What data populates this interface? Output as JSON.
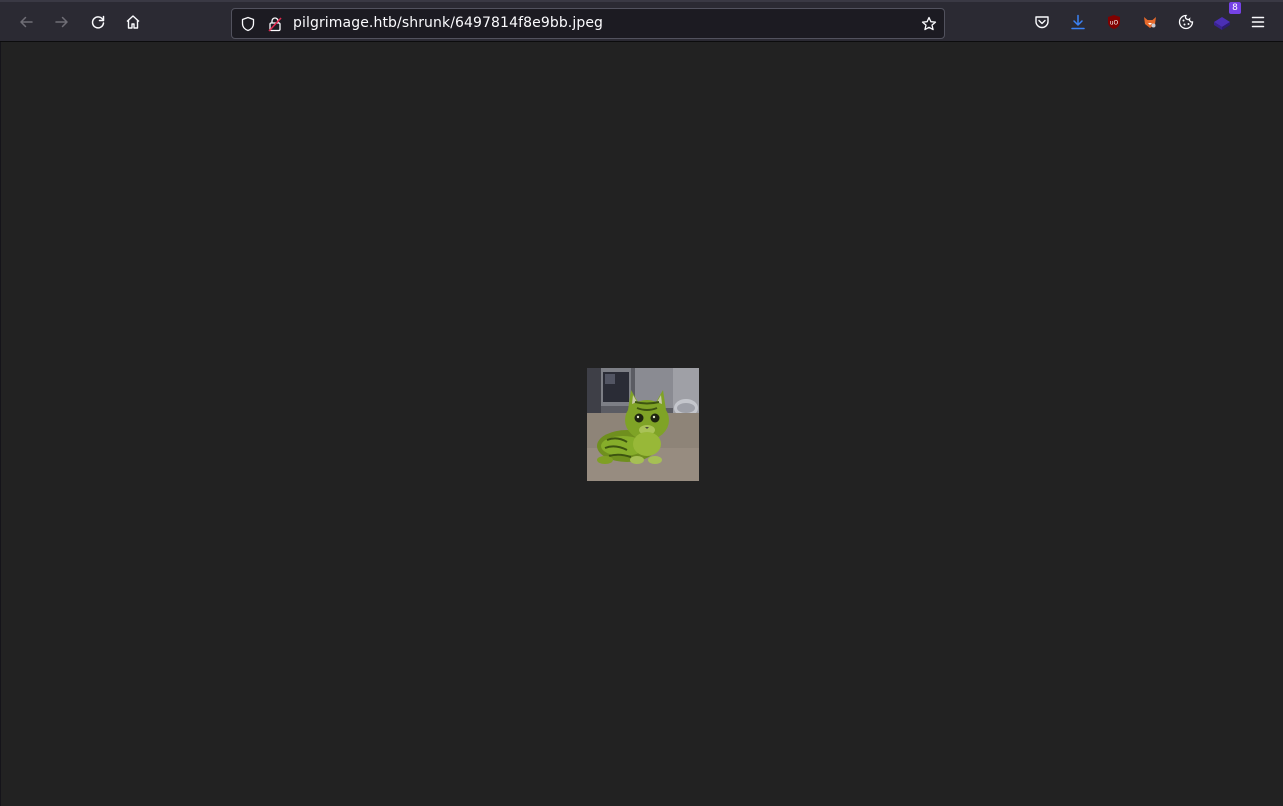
{
  "browser": {
    "url": "pilgrimage.htb/shrunk/6497814f8e9bb.jpeg",
    "extension_badge_count": "8",
    "accent_download_color": "#3b82f6",
    "badge_color": "#7542e5"
  },
  "toolbar": {
    "back_icon": "arrow-left-icon",
    "forward_icon": "arrow-right-icon",
    "reload_icon": "reload-icon",
    "home_icon": "home-icon",
    "bookmark_icon": "star-icon",
    "pocket_icon": "pocket-icon",
    "downloads_icon": "download-icon",
    "ublock_icon": "ublock-icon",
    "foxyproxy_icon": "fox-icon",
    "cookie_icon": "cookie-icon",
    "extension_icon": "extension-icon",
    "menu_icon": "hamburger-menu-icon"
  },
  "content": {
    "background": "#222222",
    "image_subject": "green cat"
  }
}
